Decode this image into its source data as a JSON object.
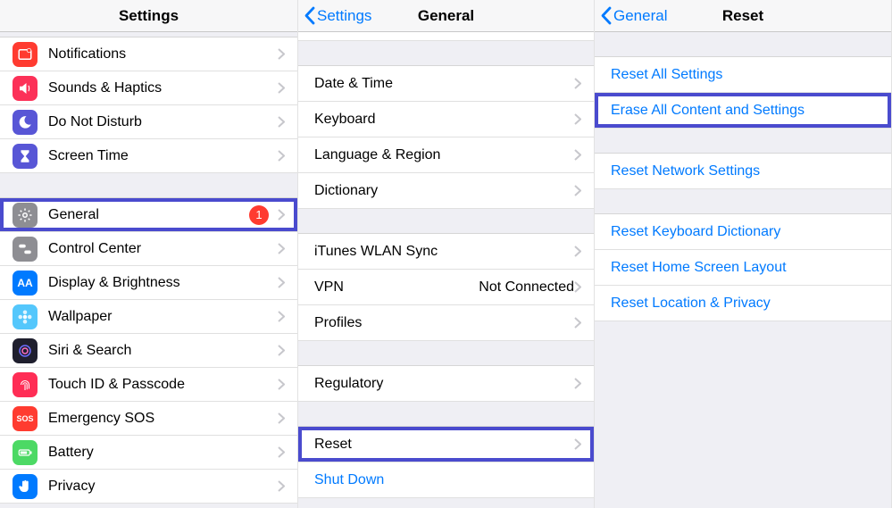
{
  "pane1": {
    "title": "Settings",
    "rows": [
      {
        "id": "notifications",
        "label": "Notifications",
        "color": "#ff3b30",
        "iconKind": "notifications"
      },
      {
        "id": "sounds",
        "label": "Sounds & Haptics",
        "color": "#fc3158",
        "iconKind": "sounds"
      },
      {
        "id": "dnd",
        "label": "Do Not Disturb",
        "color": "#5856d6",
        "iconKind": "moon"
      },
      {
        "id": "screentime",
        "label": "Screen Time",
        "color": "#5856d6",
        "iconKind": "hourglass"
      },
      {
        "id": "gap",
        "kind": "gap"
      },
      {
        "id": "general",
        "label": "General",
        "color": "#8e8e93",
        "iconKind": "gear",
        "badge": "1",
        "highlight": true
      },
      {
        "id": "controlcenter",
        "label": "Control Center",
        "color": "#8e8e93",
        "iconKind": "switches"
      },
      {
        "id": "display",
        "label": "Display & Brightness",
        "color": "#007aff",
        "iconKind": "text",
        "iconText": "AA"
      },
      {
        "id": "wallpaper",
        "label": "Wallpaper",
        "color": "#54c7fc",
        "iconKind": "flower"
      },
      {
        "id": "siri",
        "label": "Siri & Search",
        "color": "#1f1f2e",
        "iconKind": "siri"
      },
      {
        "id": "touchid",
        "label": "Touch ID & Passcode",
        "color": "#ff2d55",
        "iconKind": "fingerprint"
      },
      {
        "id": "sos",
        "label": "Emergency SOS",
        "color": "#ff3b30",
        "iconKind": "text",
        "iconText": "SOS",
        "iconTextSize": "9px"
      },
      {
        "id": "battery",
        "label": "Battery",
        "color": "#4cd964",
        "iconKind": "battery"
      },
      {
        "id": "privacy",
        "label": "Privacy",
        "color": "#007aff",
        "iconKind": "hand"
      }
    ]
  },
  "pane2": {
    "back": "Settings",
    "title": "General",
    "groups": [
      {
        "rows": [
          {
            "id": "datetime",
            "label": "Date & Time"
          },
          {
            "id": "keyboard",
            "label": "Keyboard"
          },
          {
            "id": "langregion",
            "label": "Language & Region"
          },
          {
            "id": "dictionary",
            "label": "Dictionary"
          }
        ]
      },
      {
        "rows": [
          {
            "id": "itunes",
            "label": "iTunes WLAN Sync"
          },
          {
            "id": "vpn",
            "label": "VPN",
            "detail": "Not Connected"
          },
          {
            "id": "profiles",
            "label": "Profiles"
          }
        ]
      },
      {
        "rows": [
          {
            "id": "regulatory",
            "label": "Regulatory"
          }
        ]
      },
      {
        "rows": [
          {
            "id": "reset",
            "label": "Reset",
            "highlight": true
          },
          {
            "id": "shutdown",
            "label": "Shut Down",
            "blue": true,
            "noChevron": true
          }
        ]
      }
    ]
  },
  "pane3": {
    "back": "General",
    "title": "Reset",
    "groups": [
      {
        "rows": [
          {
            "id": "reset-all",
            "label": "Reset All Settings"
          },
          {
            "id": "erase-all",
            "label": "Erase All Content and Settings",
            "highlight": true
          }
        ]
      },
      {
        "rows": [
          {
            "id": "reset-network",
            "label": "Reset Network Settings"
          }
        ]
      },
      {
        "rows": [
          {
            "id": "reset-keyboard",
            "label": "Reset Keyboard Dictionary"
          },
          {
            "id": "reset-home",
            "label": "Reset Home Screen Layout"
          },
          {
            "id": "reset-location",
            "label": "Reset Location & Privacy"
          }
        ]
      }
    ]
  }
}
